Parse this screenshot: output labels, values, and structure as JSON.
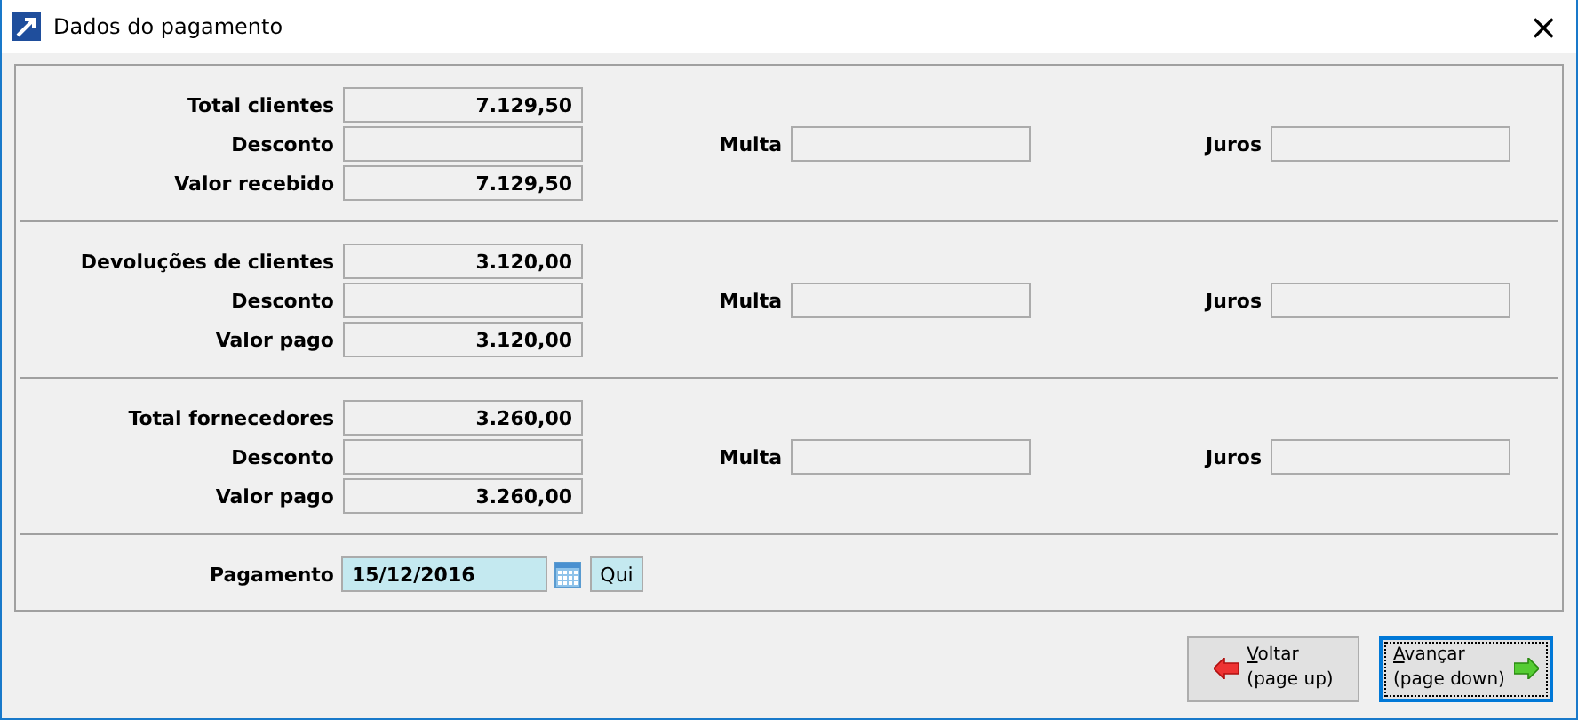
{
  "window": {
    "title": "Dados do pagamento",
    "close": "×"
  },
  "sections": [
    {
      "total": {
        "label": "Total clientes",
        "value": "7.129,50"
      },
      "desconto": {
        "label": "Desconto"
      },
      "multa": {
        "label": "Multa"
      },
      "juros": {
        "label": "Juros"
      },
      "final": {
        "label": "Valor recebido",
        "value": "7.129,50"
      }
    },
    {
      "total": {
        "label": "Devoluções de clientes",
        "value": "3.120,00"
      },
      "desconto": {
        "label": "Desconto"
      },
      "multa": {
        "label": "Multa"
      },
      "juros": {
        "label": "Juros"
      },
      "final": {
        "label": "Valor pago",
        "value": "3.120,00"
      }
    },
    {
      "total": {
        "label": "Total fornecedores",
        "value": "3.260,00"
      },
      "desconto": {
        "label": "Desconto"
      },
      "multa": {
        "label": "Multa"
      },
      "juros": {
        "label": "Juros"
      },
      "final": {
        "label": "Valor pago",
        "value": "3.260,00"
      }
    }
  ],
  "payment": {
    "label": "Pagamento",
    "value": "15/12/2016",
    "weekday": "Qui"
  },
  "buttons": [
    {
      "kind": "back",
      "label": "Voltar",
      "hint": "(page up)",
      "focused": false
    },
    {
      "kind": "next",
      "label": "Avançar",
      "hint": "(page down)",
      "focused": true
    }
  ]
}
